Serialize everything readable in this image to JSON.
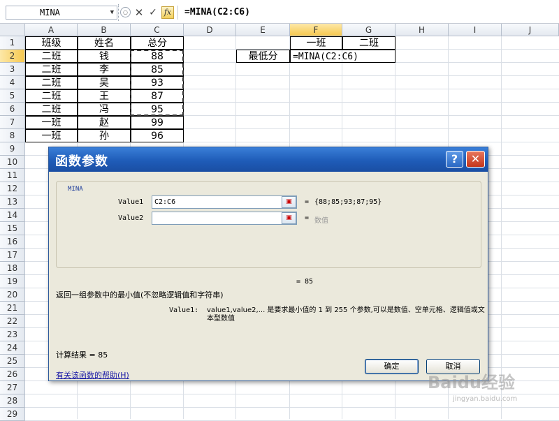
{
  "formula_bar": {
    "name_box": "MINA",
    "cancel_icon": "✕",
    "enter_icon": "✓",
    "insert_function_icon": "fx",
    "formula": "=MINA(C2:C6)"
  },
  "columns": [
    "A",
    "B",
    "C",
    "D",
    "E",
    "F",
    "G",
    "H",
    "I",
    "J"
  ],
  "selected_column": "F",
  "rows": [
    "1",
    "2",
    "3",
    "4",
    "5",
    "6",
    "7",
    "8",
    "9",
    "10",
    "11",
    "12",
    "13",
    "14",
    "15",
    "16",
    "17",
    "18",
    "19",
    "20",
    "21",
    "22",
    "23",
    "24",
    "25",
    "26",
    "27",
    "28",
    "29"
  ],
  "selected_row": "2",
  "table": {
    "headers": [
      "班级",
      "姓名",
      "总分"
    ],
    "rows": [
      [
        "二班",
        "钱",
        "88"
      ],
      [
        "二班",
        "李",
        "85"
      ],
      [
        "二班",
        "吴",
        "93"
      ],
      [
        "二班",
        "王",
        "87"
      ],
      [
        "二班",
        "冯",
        "95"
      ],
      [
        "一班",
        "赵",
        "99"
      ],
      [
        "一班",
        "孙",
        "96"
      ]
    ]
  },
  "summary": {
    "header_f": "一班",
    "header_g": "二班",
    "label": "最低分",
    "formula": "=MINA(C2:C6)"
  },
  "dialog": {
    "title": "函数参数",
    "help_icon": "?",
    "close_icon": "✕",
    "function_name": "MINA",
    "args": [
      {
        "label": "Value1",
        "value": "C2:C6",
        "result": "{88;85;93;87;95}"
      },
      {
        "label": "Value2",
        "value": "",
        "result": "数值"
      }
    ],
    "result_line": "=  85",
    "description": "返回一组参数中的最小值(不忽略逻辑值和字符串)",
    "arg_desc_name": "Value1:",
    "arg_desc_text": "value1,value2,... 是要求最小值的 1 到 255 个参数,可以是数值、空单元格、逻辑值或文本型数值",
    "calc_result": "计算结果 =  85",
    "help_link": "有关该函数的帮助(H)",
    "ok_label": "确定",
    "cancel_label": "取消"
  },
  "watermark": {
    "logo": "Baidu经验",
    "url": "jingyan.baidu.com"
  }
}
